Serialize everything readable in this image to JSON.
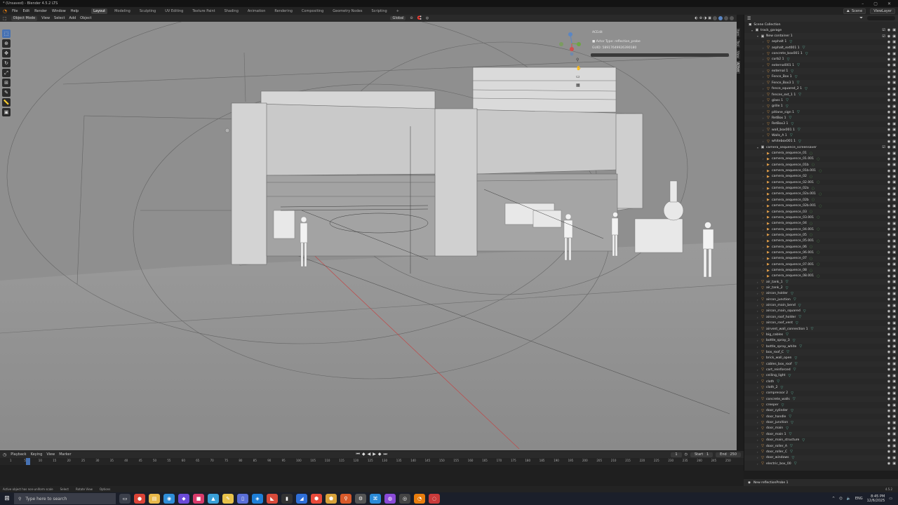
{
  "window": {
    "title": "* (Unsaved) - Blender 4.5.2 LTS",
    "controls": [
      "–",
      "▢",
      "✕"
    ]
  },
  "menu": {
    "items": [
      "File",
      "Edit",
      "Render",
      "Window",
      "Help"
    ],
    "workspaces": [
      "Layout",
      "Modeling",
      "Sculpting",
      "UV Editing",
      "Texture Paint",
      "Shading",
      "Animation",
      "Rendering",
      "Compositing",
      "Geometry Nodes",
      "Scripting"
    ],
    "active_workspace": "Layout",
    "add_tab": "+",
    "scene": "Scene",
    "view_layer": "ViewLayer"
  },
  "viewport_header": {
    "mode": "Object Mode",
    "menus": [
      "View",
      "Select",
      "Add",
      "Object"
    ],
    "orientation": "Global",
    "options": "Options"
  },
  "props_panel": {
    "title": "ACEdit",
    "actor_type": "Actor Type: reflection_probe",
    "guid": "GUID: 58917649926390180"
  },
  "side_tabs": [
    "Item",
    "Tool",
    "View",
    "ACEdit"
  ],
  "outliner": {
    "title": "Scene Collection",
    "search_placeholder": "",
    "items": [
      {
        "name": "track_garage",
        "indent": 0,
        "type": "collection",
        "color": "#cccccc"
      },
      {
        "name": "New container 1",
        "indent": 1,
        "type": "collection",
        "color": "#cccccc"
      },
      {
        "name": "asphalt 1",
        "indent": 2,
        "type": "mesh",
        "color": "#e8a24a"
      },
      {
        "name": "asphalt_ext001 1",
        "indent": 2,
        "type": "mesh",
        "color": "#e8a24a"
      },
      {
        "name": "concrete_box001 1",
        "indent": 2,
        "type": "mesh",
        "color": "#e8a24a"
      },
      {
        "name": "curb2 1",
        "indent": 2,
        "type": "mesh",
        "color": "#e8a24a"
      },
      {
        "name": "external001 1",
        "indent": 2,
        "type": "mesh",
        "color": "#e8a24a"
      },
      {
        "name": "external 1",
        "indent": 2,
        "type": "mesh",
        "color": "#e8a24a"
      },
      {
        "name": "Fence_Box 1",
        "indent": 2,
        "type": "mesh",
        "color": "#e8a24a"
      },
      {
        "name": "Fence_Box3 1",
        "indent": 2,
        "type": "mesh",
        "color": "#e8a24a"
      },
      {
        "name": "fence_squared_2 1",
        "indent": 2,
        "type": "mesh",
        "color": "#e8a24a"
      },
      {
        "name": "fences_ext_1 1",
        "indent": 2,
        "type": "mesh",
        "color": "#e8a24a"
      },
      {
        "name": "glass 1",
        "indent": 2,
        "type": "mesh",
        "color": "#e8a24a"
      },
      {
        "name": "grille 1",
        "indent": 2,
        "type": "mesh",
        "color": "#e8a24a"
      },
      {
        "name": "pitlane_sign 1",
        "indent": 2,
        "type": "mesh",
        "color": "#e8a24a"
      },
      {
        "name": "RetBox 1",
        "indent": 2,
        "type": "mesh",
        "color": "#e8a24a"
      },
      {
        "name": "RetBox3 1",
        "indent": 2,
        "type": "mesh",
        "color": "#e8a24a"
      },
      {
        "name": "wall_box001 1",
        "indent": 2,
        "type": "mesh",
        "color": "#e8a24a"
      },
      {
        "name": "Walls_A 1",
        "indent": 2,
        "type": "mesh",
        "color": "#e8a24a"
      },
      {
        "name": "whitebox001 1",
        "indent": 2,
        "type": "mesh",
        "color": "#e8a24a"
      },
      {
        "name": "camera_sequence_screensaver",
        "indent": 1,
        "type": "collection",
        "color": "#cccccc"
      },
      {
        "name": "camera_sequence_01",
        "indent": 2,
        "type": "camera",
        "color": "#e8a24a"
      },
      {
        "name": "camera_sequence_01.001",
        "indent": 2,
        "type": "camera",
        "color": "#e8a24a"
      },
      {
        "name": "camera_sequence_01b",
        "indent": 2,
        "type": "camera",
        "color": "#e8a24a"
      },
      {
        "name": "camera_sequence_01b.001",
        "indent": 2,
        "type": "camera",
        "color": "#e8a24a"
      },
      {
        "name": "camera_sequence_02",
        "indent": 2,
        "type": "camera",
        "color": "#e8a24a"
      },
      {
        "name": "camera_sequence_02.001",
        "indent": 2,
        "type": "camera",
        "color": "#e8a24a"
      },
      {
        "name": "camera_sequence_02a",
        "indent": 2,
        "type": "camera",
        "color": "#e8a24a"
      },
      {
        "name": "camera_sequence_02a.001",
        "indent": 2,
        "type": "camera",
        "color": "#e8a24a"
      },
      {
        "name": "camera_sequence_02b",
        "indent": 2,
        "type": "camera",
        "color": "#e8a24a"
      },
      {
        "name": "camera_sequence_02b.001",
        "indent": 2,
        "type": "camera",
        "color": "#e8a24a"
      },
      {
        "name": "camera_sequence_03",
        "indent": 2,
        "type": "camera",
        "color": "#e8a24a"
      },
      {
        "name": "camera_sequence_03.001",
        "indent": 2,
        "type": "camera",
        "color": "#e8a24a"
      },
      {
        "name": "camera_sequence_04",
        "indent": 2,
        "type": "camera",
        "color": "#e8a24a"
      },
      {
        "name": "camera_sequence_04.001",
        "indent": 2,
        "type": "camera",
        "color": "#e8a24a"
      },
      {
        "name": "camera_sequence_05",
        "indent": 2,
        "type": "camera",
        "color": "#e8a24a"
      },
      {
        "name": "camera_sequence_05.001",
        "indent": 2,
        "type": "camera",
        "color": "#e8a24a"
      },
      {
        "name": "camera_sequence_06",
        "indent": 2,
        "type": "camera",
        "color": "#e8a24a"
      },
      {
        "name": "camera_sequence_06.001",
        "indent": 2,
        "type": "camera",
        "color": "#e8a24a"
      },
      {
        "name": "camera_sequence_07",
        "indent": 2,
        "type": "camera",
        "color": "#e8a24a"
      },
      {
        "name": "camera_sequence_07.001",
        "indent": 2,
        "type": "camera",
        "color": "#e8a24a"
      },
      {
        "name": "camera_sequence_08",
        "indent": 2,
        "type": "camera",
        "color": "#e8a24a"
      },
      {
        "name": "camera_sequence_08.001",
        "indent": 2,
        "type": "camera",
        "color": "#e8a24a"
      },
      {
        "name": "air_tank_1",
        "indent": 1,
        "type": "mesh",
        "color": "#e8a24a"
      },
      {
        "name": "air_tank_2",
        "indent": 1,
        "type": "mesh",
        "color": "#e8a24a"
      },
      {
        "name": "aircon_holder",
        "indent": 1,
        "type": "mesh",
        "color": "#e8a24a"
      },
      {
        "name": "aircon_junction",
        "indent": 1,
        "type": "mesh",
        "color": "#e8a24a"
      },
      {
        "name": "aircon_main_bend",
        "indent": 1,
        "type": "mesh",
        "color": "#e8a24a"
      },
      {
        "name": "aircon_main_squared",
        "indent": 1,
        "type": "mesh",
        "color": "#e8a24a"
      },
      {
        "name": "aircon_roof_holder",
        "indent": 1,
        "type": "mesh",
        "color": "#e8a24a"
      },
      {
        "name": "aircon_roof_vent",
        "indent": 1,
        "type": "mesh",
        "color": "#e8a24a"
      },
      {
        "name": "airvent_wall_connection 1",
        "indent": 1,
        "type": "mesh",
        "color": "#e8a24a"
      },
      {
        "name": "big_cables",
        "indent": 1,
        "type": "mesh",
        "color": "#e8a24a"
      },
      {
        "name": "bottle_spray_3",
        "indent": 1,
        "type": "mesh",
        "color": "#e8a24a"
      },
      {
        "name": "bottle_spray_white",
        "indent": 1,
        "type": "mesh",
        "color": "#e8a24a"
      },
      {
        "name": "box_roof_C",
        "indent": 1,
        "type": "mesh",
        "color": "#e8a24a"
      },
      {
        "name": "brick_wall_open",
        "indent": 1,
        "type": "mesh",
        "color": "#e8a24a"
      },
      {
        "name": "cables_box_roof",
        "indent": 1,
        "type": "mesh",
        "color": "#e8a24a"
      },
      {
        "name": "cart_reinforced",
        "indent": 1,
        "type": "mesh",
        "color": "#e8a24a"
      },
      {
        "name": "ceiling_light",
        "indent": 1,
        "type": "mesh",
        "color": "#e8a24a"
      },
      {
        "name": "cloth",
        "indent": 1,
        "type": "mesh",
        "color": "#e8a24a"
      },
      {
        "name": "cloth_2",
        "indent": 1,
        "type": "mesh",
        "color": "#e8a24a"
      },
      {
        "name": "compressor 2",
        "indent": 1,
        "type": "mesh",
        "color": "#e8a24a"
      },
      {
        "name": "concrete_walls",
        "indent": 1,
        "type": "mesh",
        "color": "#e8a24a"
      },
      {
        "name": "creeper",
        "indent": 1,
        "type": "mesh",
        "color": "#e8a24a"
      },
      {
        "name": "door_cylinder",
        "indent": 1,
        "type": "mesh",
        "color": "#e8a24a"
      },
      {
        "name": "door_handle",
        "indent": 1,
        "type": "mesh",
        "color": "#e8a24a"
      },
      {
        "name": "door_junction",
        "indent": 1,
        "type": "mesh",
        "color": "#e8a24a"
      },
      {
        "name": "door_main",
        "indent": 1,
        "type": "mesh",
        "color": "#e8a24a"
      },
      {
        "name": "door_main 1",
        "indent": 1,
        "type": "mesh",
        "color": "#e8a24a"
      },
      {
        "name": "door_main_structure",
        "indent": 1,
        "type": "mesh",
        "color": "#e8a24a"
      },
      {
        "name": "door_roller_A",
        "indent": 1,
        "type": "mesh",
        "color": "#e8a24a"
      },
      {
        "name": "door_roller_C",
        "indent": 1,
        "type": "mesh",
        "color": "#e8a24a"
      },
      {
        "name": "door_windows",
        "indent": 1,
        "type": "mesh",
        "color": "#e8a24a"
      },
      {
        "name": "electric_box_00",
        "indent": 1,
        "type": "mesh",
        "color": "#e8a24a"
      }
    ],
    "bottom_item": "New reflectionProbe 1"
  },
  "timeline": {
    "menus": [
      "Playback",
      "Keying",
      "View",
      "Marker"
    ],
    "current_frame": "1",
    "start_label": "Start",
    "start": "1",
    "end_label": "End",
    "end": "250",
    "ticks": [
      "1",
      "5",
      "10",
      "15",
      "20",
      "25",
      "30",
      "35",
      "40",
      "45",
      "50",
      "55",
      "60",
      "65",
      "70",
      "75",
      "80",
      "85",
      "90",
      "95",
      "100",
      "105",
      "110",
      "115",
      "120",
      "125",
      "130",
      "135",
      "140",
      "145",
      "150",
      "155",
      "160",
      "165",
      "170",
      "175",
      "180",
      "185",
      "190",
      "195",
      "200",
      "205",
      "210",
      "215",
      "220",
      "225",
      "230",
      "235",
      "240",
      "245",
      "250"
    ]
  },
  "statusbar": {
    "items": [
      "Active object has non-uniform scale",
      "Select",
      "Rotate View",
      "Options"
    ],
    "version": "4.5.2"
  },
  "taskbar": {
    "search_placeholder": "Type here to search",
    "apps": [
      {
        "name": "task-view",
        "glyph": "▭",
        "color": "#3b3f4a"
      },
      {
        "name": "chrome",
        "glyph": "●",
        "color": "#db4437"
      },
      {
        "name": "explorer",
        "glyph": "▤",
        "color": "#e8b84a"
      },
      {
        "name": "edge",
        "glyph": "◉",
        "color": "#2f8ed8"
      },
      {
        "name": "app4",
        "glyph": "◆",
        "color": "#6b4ad8"
      },
      {
        "name": "app5",
        "glyph": "■",
        "color": "#d83b6b"
      },
      {
        "name": "app6",
        "glyph": "▲",
        "color": "#3aa0d8"
      },
      {
        "name": "app7",
        "glyph": "✎",
        "color": "#e8c24a"
      },
      {
        "name": "notepad",
        "glyph": "▯",
        "color": "#5a6fd8"
      },
      {
        "name": "app9",
        "glyph": "◈",
        "color": "#1e7fd8"
      },
      {
        "name": "app10",
        "glyph": "◣",
        "color": "#d84a3a"
      },
      {
        "name": "terminal",
        "glyph": "▮",
        "color": "#333333"
      },
      {
        "name": "app12",
        "glyph": "◢",
        "color": "#2f6fd8"
      },
      {
        "name": "app13",
        "glyph": "⬢",
        "color": "#e84a3a"
      },
      {
        "name": "app14",
        "glyph": "⬟",
        "color": "#d8a23a"
      },
      {
        "name": "app15",
        "glyph": "⚲",
        "color": "#d85a2a"
      },
      {
        "name": "settings",
        "glyph": "⚙",
        "color": "#555555"
      },
      {
        "name": "vscode",
        "glyph": "⌘",
        "color": "#2a8ad8"
      },
      {
        "name": "app18",
        "glyph": "◍",
        "color": "#8a4ad8"
      },
      {
        "name": "obs",
        "glyph": "◎",
        "color": "#444444"
      },
      {
        "name": "blender",
        "glyph": "◔",
        "color": "#e87d0d"
      },
      {
        "name": "app21",
        "glyph": "◌",
        "color": "#c83a3a"
      }
    ],
    "lang": "ENG",
    "time": "8:45 PM",
    "date": "12/6/2025"
  }
}
